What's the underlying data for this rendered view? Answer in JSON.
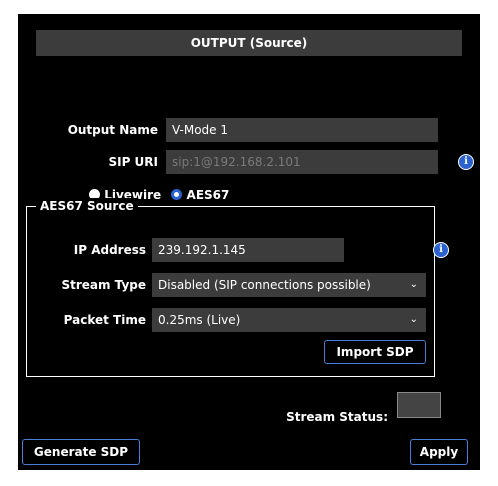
{
  "header": {
    "title": "OUTPUT (Source)"
  },
  "output_name": {
    "label": "Output Name",
    "value": "V-Mode 1"
  },
  "sip_uri": {
    "label": "SIP URI",
    "placeholder": "sip:1@192.168.2.101"
  },
  "source_type": {
    "options": [
      "Livewire",
      "AES67"
    ],
    "selected": "AES67"
  },
  "aes67": {
    "legend": "AES67 Source",
    "ip_address": {
      "label": "IP Address",
      "value": "239.192.1.145"
    },
    "stream_type": {
      "label": "Stream Type",
      "value": "Disabled (SIP connections possible)"
    },
    "packet_time": {
      "label": "Packet Time",
      "value": "0.25ms (Live)"
    },
    "import_label": "Import SDP"
  },
  "stream_status": {
    "label": "Stream Status:"
  },
  "footer": {
    "generate_label": "Generate SDP",
    "apply_label": "Apply"
  },
  "colors": {
    "accent": "#2a62d0",
    "field_bg": "#3c3c3c",
    "panel_bg": "#000000"
  },
  "icons": [
    "info-icon",
    "chevron-down-icon",
    "radio-icon"
  ]
}
